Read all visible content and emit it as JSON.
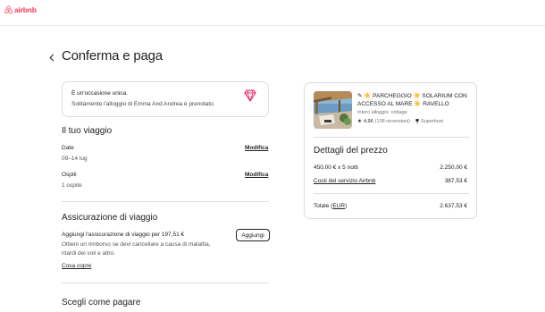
{
  "header": {
    "logo_text": "airbnb",
    "brand_color": "#ff385c"
  },
  "page": {
    "title": "Conferma e paga"
  },
  "rare_notice": {
    "title": "È un'occasione unica.",
    "subtitle": "Solitamente l'alloggio di Emma And Andrea è prenotato."
  },
  "trip": {
    "heading": "Il tuo viaggio",
    "dates_label": "Date",
    "dates_value": "09–14 lug",
    "dates_edit": "Modifica",
    "guests_label": "Ospiti",
    "guests_value": "1 ospite",
    "guests_edit": "Modifica"
  },
  "insurance": {
    "heading": "Assicurazione di viaggio",
    "line": "Aggiungi l'assicurazione di viaggio per 197,51 €",
    "description": "Ottieni un rimborso se devi cancellare a causa di malattia, ritardi dei voli e altro.",
    "link": "Cosa copre",
    "add_button": "Aggiungi"
  },
  "payment": {
    "heading": "Scegli come pagare"
  },
  "listing": {
    "title": "✎ ☀️ PARCHEGGIO ☀️ SOLARIUM CON ACCESSO AL MARE ☀️ RAVELLO",
    "type": "Intero alloggio: cottage",
    "rating": "4,96",
    "reviews": "(138 recensioni)",
    "separator": "·",
    "badge": "Superhost"
  },
  "price": {
    "heading": "Dettagli del prezzo",
    "nights_label": "450,00 € x 5 notti",
    "nights_value": "2.250,00 €",
    "fee_label": "Costi del servizio Airbnb",
    "fee_value": "387,53 €",
    "total_label_prefix": "Totale (",
    "total_currency": "EUR",
    "total_label_suffix": ")",
    "total_value": "2.637,53 €"
  }
}
